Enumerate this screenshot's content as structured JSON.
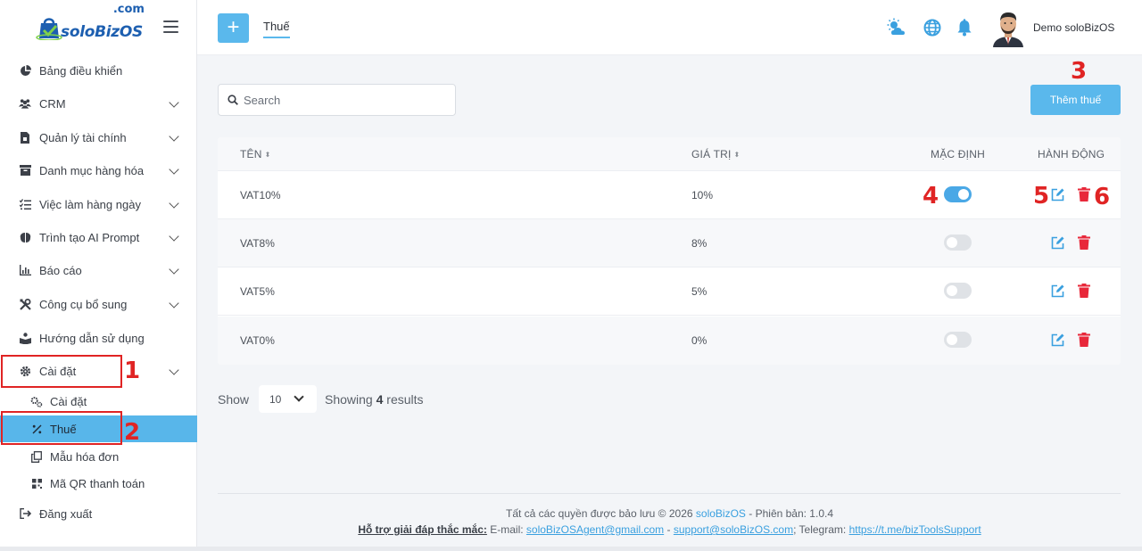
{
  "brand": {
    "name": "soloBizOS",
    "tld": ".com"
  },
  "sidebar": {
    "items": [
      {
        "label": "Bảng điều khiển",
        "icon": "pie-chart-icon"
      },
      {
        "label": "CRM",
        "icon": "users-icon"
      },
      {
        "label": "Quản lý tài chính",
        "icon": "finance-file-icon"
      },
      {
        "label": "Danh mục hàng hóa",
        "icon": "box-icon"
      },
      {
        "label": "Việc làm hàng ngày",
        "icon": "checklist-icon"
      },
      {
        "label": "Trình tạo AI Prompt",
        "icon": "brain-icon"
      },
      {
        "label": "Báo cáo",
        "icon": "report-chart-icon"
      },
      {
        "label": "Công cụ bổ sung",
        "icon": "tools-icon"
      },
      {
        "label": "Hướng dẫn sử dụng",
        "icon": "guide-icon"
      },
      {
        "label": "Cài đặt",
        "icon": "gear-icon"
      }
    ],
    "sub_items": [
      {
        "label": "Cài đặt",
        "icon": "gears-icon"
      },
      {
        "label": "Thuế",
        "icon": "percent-icon"
      },
      {
        "label": "Mẫu hóa đơn",
        "icon": "copy-icon"
      },
      {
        "label": "Mã QR thanh toán",
        "icon": "qr-code-icon"
      }
    ],
    "logout": {
      "label": "Đăng xuất",
      "icon": "logout-icon"
    }
  },
  "header": {
    "add_label": "+",
    "tab": "Thuế",
    "user_name": "Demo soloBizOS"
  },
  "toolbar": {
    "search_placeholder": "Search",
    "add_tax_label": "Thêm thuế"
  },
  "table": {
    "columns": [
      "TÊN",
      "GIÁ TRỊ",
      "MẶC ĐỊNH",
      "HÀNH ĐỘNG"
    ],
    "sort_glyph": "⬍",
    "rows": [
      {
        "name": "VAT10%",
        "value": "10%",
        "default": true
      },
      {
        "name": "VAT8%",
        "value": "8%",
        "default": false
      },
      {
        "name": "VAT5%",
        "value": "5%",
        "default": false
      },
      {
        "name": "VAT0%",
        "value": "0%",
        "default": false
      }
    ]
  },
  "pagination": {
    "show_label": "Show",
    "page_size": "10",
    "showing_prefix": "Showing",
    "count": "4",
    "showing_suffix": "results"
  },
  "annotations": [
    "1",
    "2",
    "3",
    "4",
    "5",
    "6"
  ],
  "footer": {
    "copyright_prefix": "Tất cả các quyền được bảo lưu © 2026",
    "brand_link": "soloBizOS",
    "version": "- Phiên bản: 1.0.4",
    "support_label": "Hỗ trợ giải đáp thắc mắc:",
    "email_label": "E-mail:",
    "email1": "soloBizOSAgent@gmail.com",
    "sep": "-",
    "email2": "support@soloBizOS.com",
    "telegram_label": "; Telegram:",
    "telegram": "https://t.me/bizToolsSupport"
  },
  "colors": {
    "accent": "#5ab8ec",
    "annotation": "#e02424",
    "delete": "#e8283a",
    "edit": "#3aa0df"
  }
}
